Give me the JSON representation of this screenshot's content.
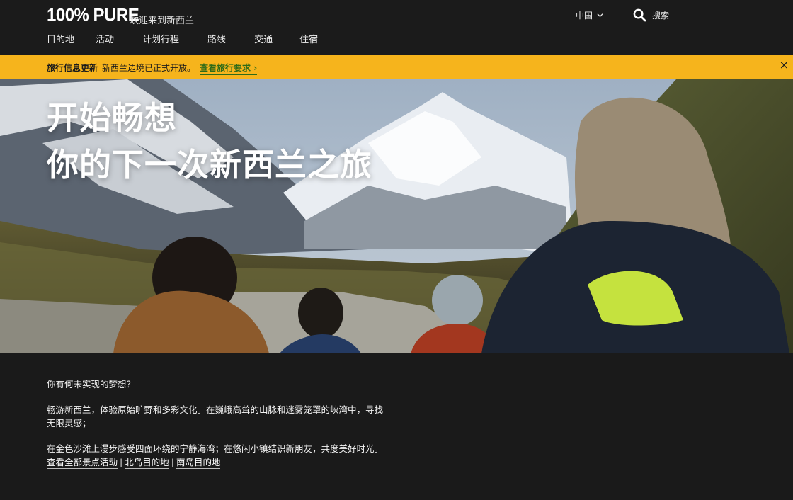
{
  "header": {
    "logo": "100% PURE",
    "welcome": "欢迎来到新西兰",
    "region": "中国",
    "search_label": "搜索",
    "nav": [
      "目的地",
      "活动",
      "计划行程",
      "路线",
      "交通",
      "住宿"
    ]
  },
  "alert": {
    "title": "旅行信息更新",
    "message": "新西兰边境已正式开放。",
    "link_label": "查看旅行要求",
    "link_arrow": "›",
    "close_label": "×"
  },
  "hero": {
    "line1": "开始畅想",
    "line2": "你的下一次新西兰之旅"
  },
  "content": {
    "question": "你有何未实现的梦想？",
    "para1": "畅游新西兰，体验原始旷野和多彩文化。在巍峨高耸的山脉和迷雾笼罩的峡湾中，寻找无限灵感；",
    "para2": "在金色沙滩上漫步感受四面环绕的宁静海湾；在悠闲小镇结识新朋友，共度美好时光。",
    "links": [
      "查看全部景点活动",
      "北岛目的地",
      "南岛目的地"
    ],
    "separator": "|"
  },
  "colors": {
    "header_bg": "#1b1b1b",
    "alert_bg": "#f6b41c",
    "alert_link": "#2e6b18",
    "page_bg": "#1a1a1a"
  }
}
